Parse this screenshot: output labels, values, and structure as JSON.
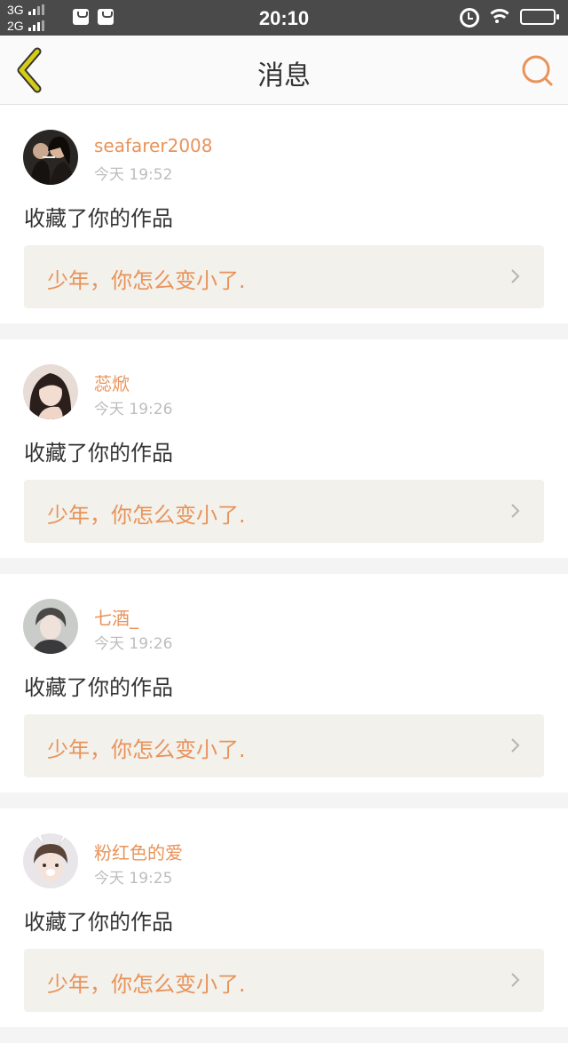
{
  "status_bar": {
    "network_1": "3G",
    "network_2": "2G",
    "time": "20:10",
    "icons": [
      "shopping-bag-icon",
      "mail-icon",
      "alarm-icon",
      "wifi-icon",
      "battery-icon"
    ]
  },
  "header": {
    "title": "消息",
    "back_icon": "chevron-left-icon",
    "search_icon": "search-icon"
  },
  "colors": {
    "accent": "#e8935a",
    "back_icon": "#d4cc17",
    "status_bar": "#4a4a4a",
    "quote_bg": "#f2f1ec"
  },
  "messages": [
    {
      "username": "seafarer2008",
      "time": "今天 19:52",
      "action": "收藏了你的作品",
      "work_title": "少年，你怎么变小了."
    },
    {
      "username": "蕊焮",
      "time": "今天 19:26",
      "action": "收藏了你的作品",
      "work_title": "少年，你怎么变小了."
    },
    {
      "username": "七酒_",
      "time": "今天 19:26",
      "action": "收藏了你的作品",
      "work_title": "少年，你怎么变小了."
    },
    {
      "username": "粉红色的爱",
      "time": "今天 19:25",
      "action": "收藏了你的作品",
      "work_title": "少年，你怎么变小了."
    }
  ]
}
